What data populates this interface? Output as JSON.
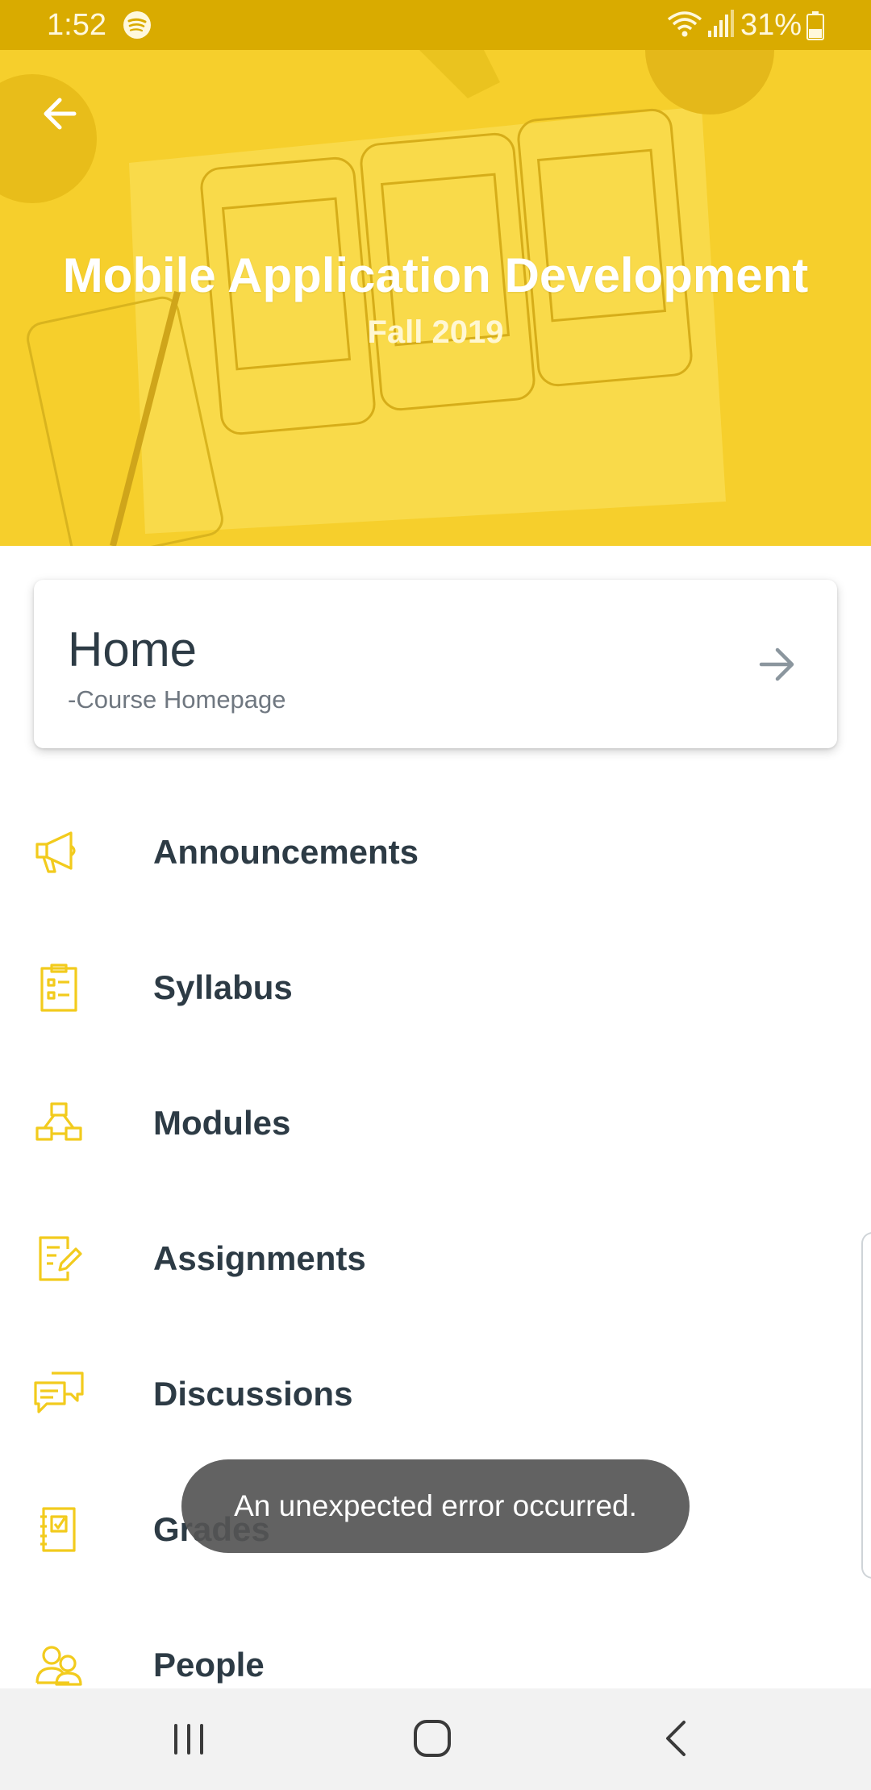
{
  "status_bar": {
    "time": "1:52",
    "battery": "31%",
    "icons": [
      "spotify-icon",
      "wifi-icon",
      "signal-icon",
      "battery-icon"
    ]
  },
  "header": {
    "course_title": "Mobile Application Development",
    "term": "Fall 2019",
    "back_icon": "arrow-left-icon",
    "banner_color": "#f6cf2c"
  },
  "home_card": {
    "title": "Home",
    "subtitle": "-Course Homepage",
    "icon": "arrow-right-icon"
  },
  "menu": {
    "items": [
      {
        "label": "Announcements",
        "icon": "megaphone-icon"
      },
      {
        "label": "Syllabus",
        "icon": "clipboard-icon"
      },
      {
        "label": "Modules",
        "icon": "modules-icon"
      },
      {
        "label": "Assignments",
        "icon": "assignment-icon"
      },
      {
        "label": "Discussions",
        "icon": "chat-bubbles-icon"
      },
      {
        "label": "Grades",
        "icon": "gradebook-icon"
      },
      {
        "label": "People",
        "icon": "people-icon"
      }
    ]
  },
  "toast": {
    "message": "An unexpected error occurred."
  },
  "nav_bar": {
    "icons": [
      "recents-icon",
      "home-icon",
      "back-icon"
    ]
  },
  "colors": {
    "status_bar": "#d9ab00",
    "accent": "#f2cb1d",
    "text": "#2d3b45",
    "subtext": "#6f7780"
  }
}
